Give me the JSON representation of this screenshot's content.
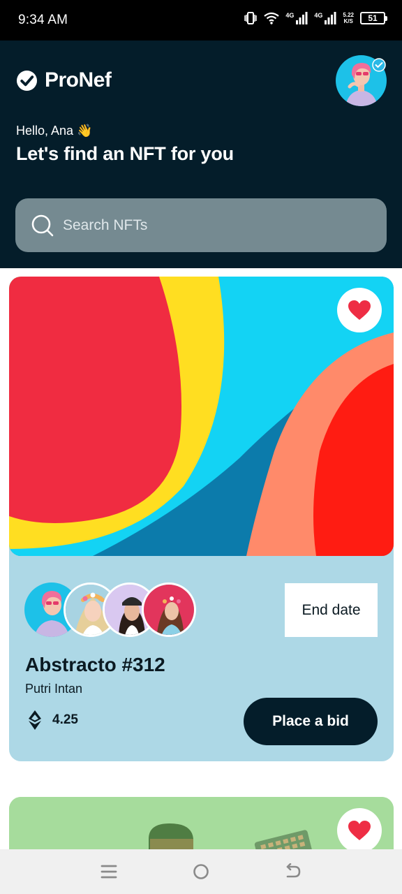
{
  "status_bar": {
    "time": "9:34 AM",
    "network_1": "4G",
    "network_2": "4G",
    "speed_value": "5.22",
    "speed_unit": "K/S",
    "battery": "51"
  },
  "header": {
    "brand": "ProNef",
    "greeting": "Hello, Ana 👋",
    "headline": "Let's find an NFT for you"
  },
  "search": {
    "placeholder": "Search NFTs"
  },
  "card": {
    "end_date_label": "End date",
    "title": "Abstracto #312",
    "creator": "Putri Intan",
    "price": "4.25",
    "bid_label": "Place a bid",
    "favorited": true,
    "owner_count": 4
  },
  "colors": {
    "header_bg": "#041d2a",
    "card_bg": "#add8e6",
    "card2_bg": "#a6dc9c",
    "heart": "#ee2d44",
    "search_bg": "#758a91"
  },
  "icons": [
    "check-logo-icon",
    "verified-icon",
    "search-icon",
    "heart-icon",
    "ethereum-icon",
    "menu-icon",
    "home-icon",
    "back-icon"
  ]
}
